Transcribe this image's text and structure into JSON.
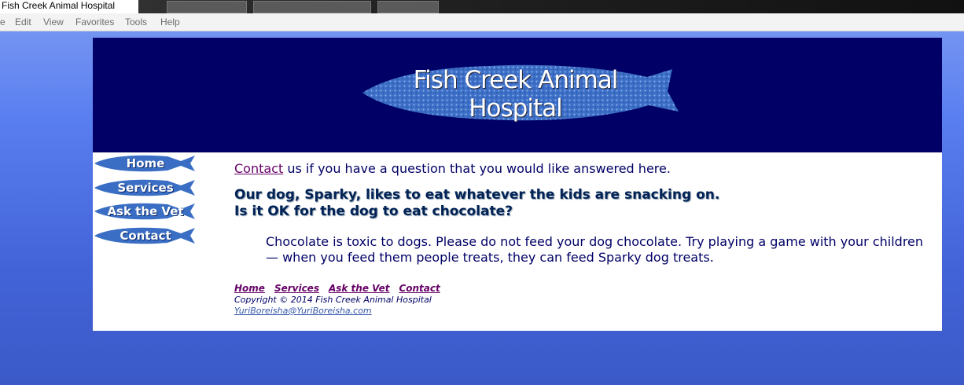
{
  "browser": {
    "tab_title": "Fish Creek Animal Hospital",
    "menu": [
      "Edit",
      "View",
      "Favorites",
      "Tools",
      "Help"
    ],
    "menu_first_partial": "e"
  },
  "site": {
    "title": "Fish Creek Animal Hospital",
    "nav": [
      "Home",
      "Services",
      "Ask the Vet",
      "Contact"
    ],
    "colors": {
      "banner": "#000066",
      "fish": "#3a6ec4",
      "text": "#000066",
      "link": "#660066"
    }
  },
  "content": {
    "intro_link": "Contact",
    "intro_rest": " us if you have a question that you would like answered here.",
    "question_line1": "Our dog, Sparky, likes to eat whatever the kids are snacking on.",
    "question_line2": "Is it OK for the dog to eat chocolate?",
    "answer": "Chocolate is toxic to dogs. Please do not feed your dog chocolate. Try playing a game with your children — when you feed them people treats, they can feed Sparky dog treats."
  },
  "footer": {
    "links": [
      "Home",
      "Services",
      "Ask the Vet",
      "Contact"
    ],
    "copyright": "Copyright © 2014 Fish Creek Animal Hospital",
    "email": "YuriBoreisha@YuriBoreisha.com"
  }
}
